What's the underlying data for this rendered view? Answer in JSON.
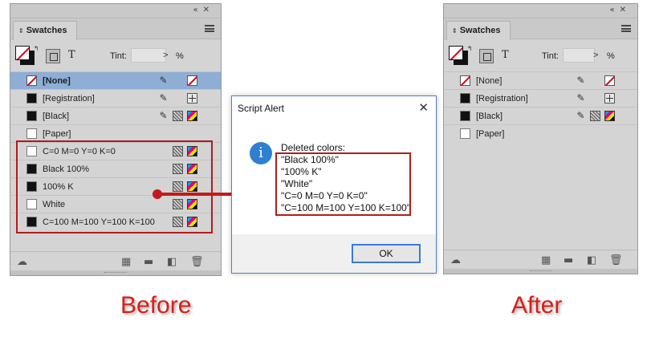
{
  "panel_before": {
    "title": "Swatches",
    "tint_label": "Tint:",
    "tint_value": "",
    "pct": "%",
    "rows": [
      {
        "name": "[None]",
        "swatch": "none",
        "selected": true,
        "icons": [
          "no-edit",
          "none-type"
        ]
      },
      {
        "name": "[Registration]",
        "swatch": "black",
        "selected": false,
        "icons": [
          "no-edit",
          "registration"
        ]
      },
      {
        "name": "[Black]",
        "swatch": "black",
        "selected": false,
        "icons": [
          "no-edit",
          "process",
          "cmyk"
        ]
      },
      {
        "name": "[Paper]",
        "swatch": "white",
        "selected": false,
        "icons": []
      },
      {
        "name": "C=0 M=0 Y=0 K=0",
        "swatch": "white",
        "selected": false,
        "icons": [
          "process",
          "cmyk"
        ]
      },
      {
        "name": "Black 100%",
        "swatch": "black",
        "selected": false,
        "icons": [
          "process",
          "cmyk"
        ]
      },
      {
        "name": "100% K",
        "swatch": "black",
        "selected": false,
        "icons": [
          "process",
          "cmyk"
        ]
      },
      {
        "name": "White",
        "swatch": "white",
        "selected": false,
        "icons": [
          "process",
          "cmyk"
        ]
      },
      {
        "name": "C=100 M=100 Y=100 K=100",
        "swatch": "black",
        "selected": false,
        "icons": [
          "process",
          "cmyk"
        ]
      }
    ]
  },
  "panel_after": {
    "title": "Swatches",
    "tint_label": "Tint:",
    "tint_value": "",
    "pct": "%",
    "rows": [
      {
        "name": "[None]",
        "swatch": "none",
        "selected": false,
        "icons": [
          "no-edit",
          "none-type"
        ]
      },
      {
        "name": "[Registration]",
        "swatch": "black",
        "selected": false,
        "icons": [
          "no-edit",
          "registration"
        ]
      },
      {
        "name": "[Black]",
        "swatch": "black",
        "selected": false,
        "icons": [
          "no-edit",
          "process",
          "cmyk"
        ]
      },
      {
        "name": "[Paper]",
        "swatch": "white",
        "selected": false,
        "icons": []
      }
    ]
  },
  "dialog": {
    "title": "Script Alert",
    "close": "✕",
    "lines": [
      "Deleted colors:",
      "\"Black 100%\"",
      "\"100% K\"",
      "\"White\"",
      "\"C=0 M=0 Y=0 K=0\"",
      "\"C=100 M=100 Y=100 K=100\""
    ],
    "ok_label": "OK"
  },
  "captions": {
    "before": "Before",
    "after": "After"
  },
  "colors": {
    "highlight": "#b41b1b",
    "caption": "#d5201b",
    "selection": "#8eaed6",
    "info_icon": "#2f7fd1"
  }
}
